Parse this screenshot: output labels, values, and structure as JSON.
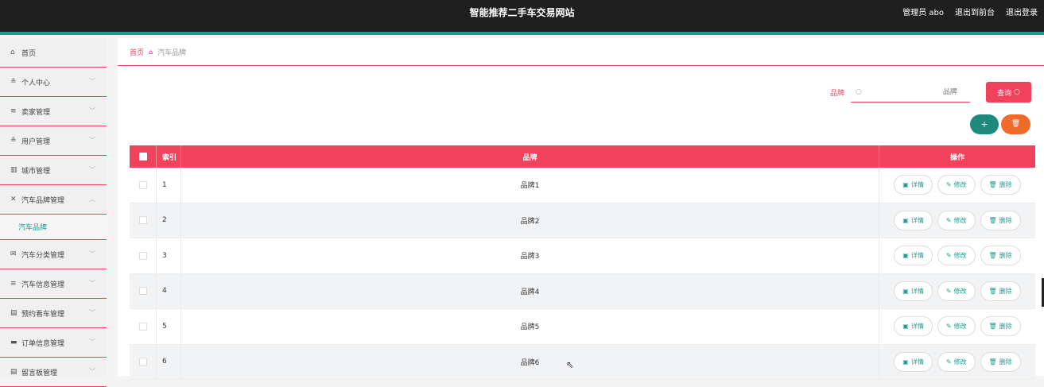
{
  "header": {
    "title": "智能推荐二手车交易网站",
    "admin": "管理员 abo",
    "to_front": "退出到前台",
    "logout": "退出登录"
  },
  "sidebar": {
    "items": [
      {
        "label": "首页",
        "icon": "home-icon",
        "glyph": "⌂"
      },
      {
        "label": "个人中心",
        "icon": "user-icon",
        "glyph": "≗"
      },
      {
        "label": "卖家管理",
        "icon": "list-icon",
        "glyph": "≡"
      },
      {
        "label": "用户管理",
        "icon": "person-icon",
        "glyph": "≗"
      },
      {
        "label": "城市管理",
        "icon": "chart-icon",
        "glyph": "▥"
      },
      {
        "label": "汽车品牌管理",
        "icon": "brand-icon",
        "glyph": "✕"
      },
      {
        "label": "汽车分类管理",
        "icon": "mail-icon",
        "glyph": "✉"
      },
      {
        "label": "汽车信息管理",
        "icon": "list-icon",
        "glyph": "≡"
      },
      {
        "label": "预约看车管理",
        "icon": "calendar-icon",
        "glyph": "▤"
      },
      {
        "label": "订单信息管理",
        "icon": "order-icon",
        "glyph": "▬"
      },
      {
        "label": "留言板管理",
        "icon": "board-icon",
        "glyph": "▤"
      }
    ],
    "sub_item": "汽车品牌"
  },
  "breadcrumb": {
    "home": "首页",
    "current": "汽车品牌"
  },
  "search": {
    "label": "品牌",
    "placeholder": "品牌",
    "button": "查询"
  },
  "actions": {
    "add": "+",
    "delete": "🗑"
  },
  "table": {
    "headers": {
      "index": "索引",
      "name": "品牌",
      "ops": "操作"
    },
    "rows": [
      {
        "index": "1",
        "name": "品牌1"
      },
      {
        "index": "2",
        "name": "品牌2"
      },
      {
        "index": "3",
        "name": "品牌3"
      },
      {
        "index": "4",
        "name": "品牌4"
      },
      {
        "index": "5",
        "name": "品牌5"
      },
      {
        "index": "6",
        "name": "品牌6"
      }
    ],
    "op_labels": {
      "detail": "详情",
      "edit": "修改",
      "remove": "删除"
    }
  },
  "colors": {
    "accent": "#f0425d",
    "teal": "#1e9b8c",
    "orange": "#f26a2a",
    "header_bg": "#1f1f1f"
  }
}
